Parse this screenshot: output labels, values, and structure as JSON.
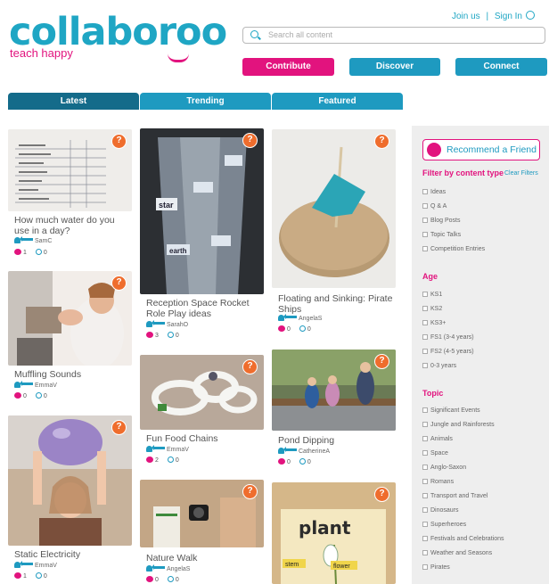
{
  "header": {
    "logo_text": "collaboroo",
    "tagline": "teach happy",
    "join_us": "Join us",
    "separator": "|",
    "sign_in": "Sign In",
    "search_placeholder": "Search all content",
    "contribute": "Contribute",
    "discover": "Discover",
    "connect": "Connect"
  },
  "tabs": {
    "latest": "Latest",
    "trending": "Trending",
    "featured": "Featured"
  },
  "cards": [
    {
      "title": "How much water do you use in a day?",
      "author": "SamC",
      "likes": "1",
      "comments": "0",
      "badge": "?"
    },
    {
      "title": "Muffling Sounds",
      "author": "EmmaV",
      "likes": "0",
      "comments": "0",
      "badge": "?"
    },
    {
      "title": "Static Electricity",
      "author": "EmmaV",
      "likes": "1",
      "comments": "0",
      "badge": "?"
    },
    {
      "title": "Reception Space Rocket Role Play ideas",
      "author": "SarahO",
      "likes": "3",
      "comments": "0",
      "badge": "?"
    },
    {
      "title": "Fun Food Chains",
      "author": "EmmaV",
      "likes": "2",
      "comments": "0",
      "badge": "?"
    },
    {
      "title": "Nature Walk",
      "author": "AngelaS",
      "likes": "0",
      "comments": "0",
      "badge": "?"
    },
    {
      "title": "Floating and Sinking: Pirate Ships",
      "author": "AngelaS",
      "likes": "0",
      "comments": "0",
      "badge": "?"
    },
    {
      "title": "Pond Dipping",
      "author": "CatherineA",
      "likes": "0",
      "comments": "0",
      "badge": "?"
    },
    {
      "title": "",
      "author": "",
      "likes": "",
      "comments": "",
      "badge": "?"
    }
  ],
  "image_text": {
    "plant_title": "plant",
    "plant_stem": "stem",
    "plant_flower": "flower",
    "rocket_label_1": "star",
    "rocket_label_2": "earth"
  },
  "sidebar": {
    "recommend": "Recommend a Friend",
    "filter_heading": "Filter by content type",
    "clear_filters": "Clear Filters",
    "content_types": [
      "Ideas",
      "Q & A",
      "Blog Posts",
      "Topic Talks",
      "Competition Entries"
    ],
    "age_heading": "Age",
    "ages": [
      "KS1",
      "KS2",
      "KS3+",
      "FS1 (3-4 years)",
      "FS2 (4-5 years)",
      "0-3 years"
    ],
    "topic_heading": "Topic",
    "topics": [
      "Significant Events",
      "Jungle and Rainforests",
      "Animals",
      "Space",
      "Anglo-Saxon",
      "Romans",
      "Transport and Travel",
      "Dinosaurs",
      "Superheroes",
      "Festivals and Celebrations",
      "Weather and Seasons",
      "Pirates"
    ]
  },
  "colors": {
    "brand": "#1fa6c4",
    "accent": "#e2137e",
    "tab_active": "#146b8a",
    "badge": "#ef6d2d"
  }
}
